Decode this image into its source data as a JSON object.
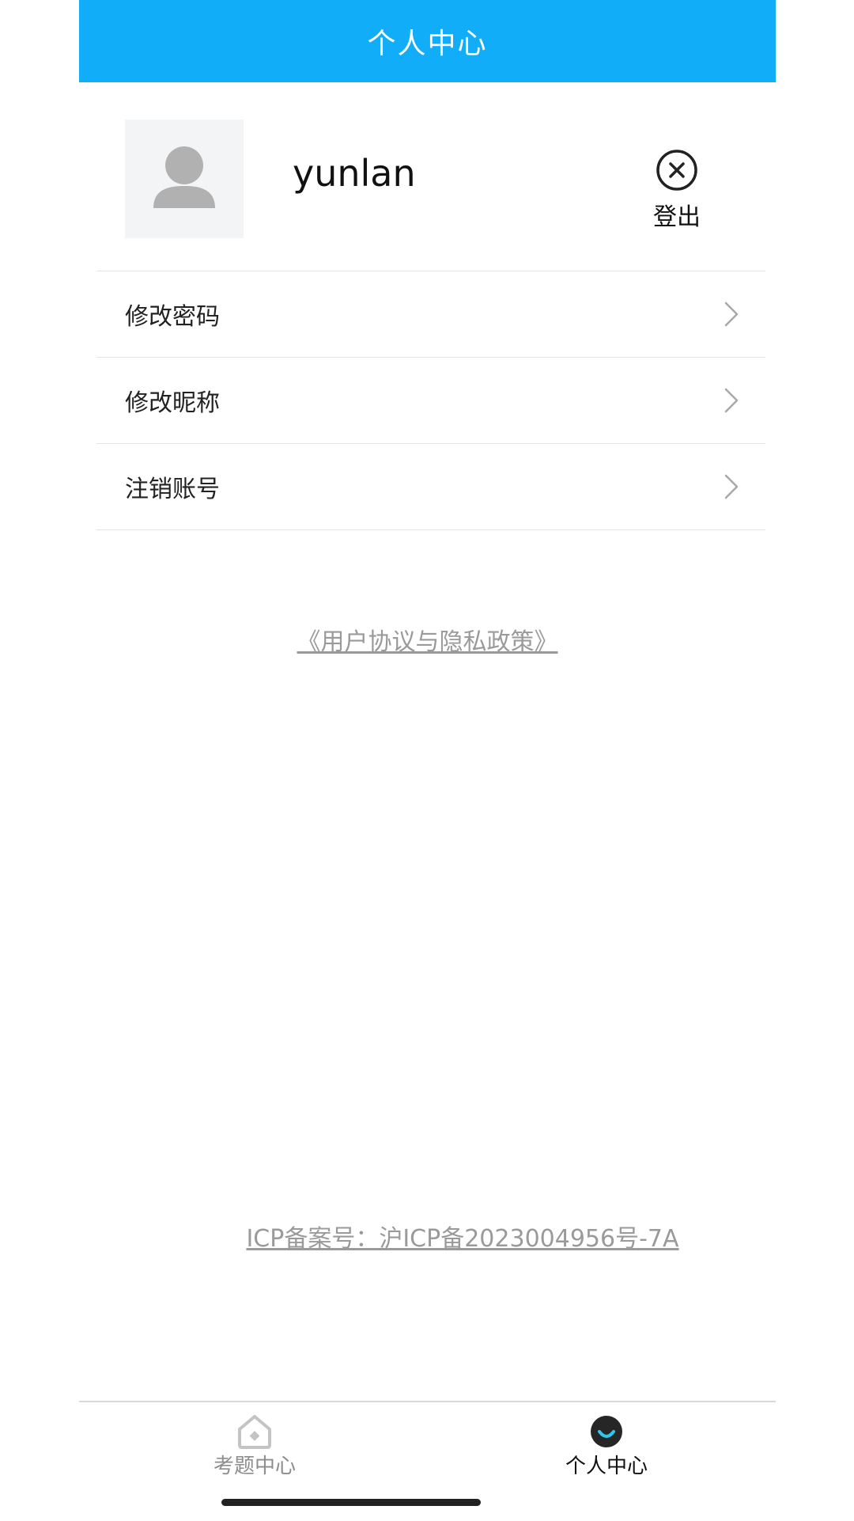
{
  "header": {
    "title": "个人中心"
  },
  "profile": {
    "avatar_icon": "user-silhouette-icon",
    "username": "yunlan",
    "logout_icon": "circle-x-icon",
    "logout_label": "登出"
  },
  "menu": {
    "items": [
      {
        "label": "修改密码",
        "icon": "chevron-right-icon"
      },
      {
        "label": "修改昵称",
        "icon": "chevron-right-icon"
      },
      {
        "label": "注销账号",
        "icon": "chevron-right-icon"
      }
    ]
  },
  "links": {
    "agreement": "《用户协议与隐私政策》",
    "icp": "ICP备案号：沪ICP备2023004956号-7A"
  },
  "bottom_nav": {
    "items": [
      {
        "label": "考题中心",
        "icon": "home-icon",
        "active": false
      },
      {
        "label": "个人中心",
        "icon": "profile-icon",
        "active": true
      }
    ]
  },
  "colors": {
    "header_bg": "#12adf8",
    "accent": "#2ec7f2",
    "muted_text": "#9a9a9a"
  }
}
